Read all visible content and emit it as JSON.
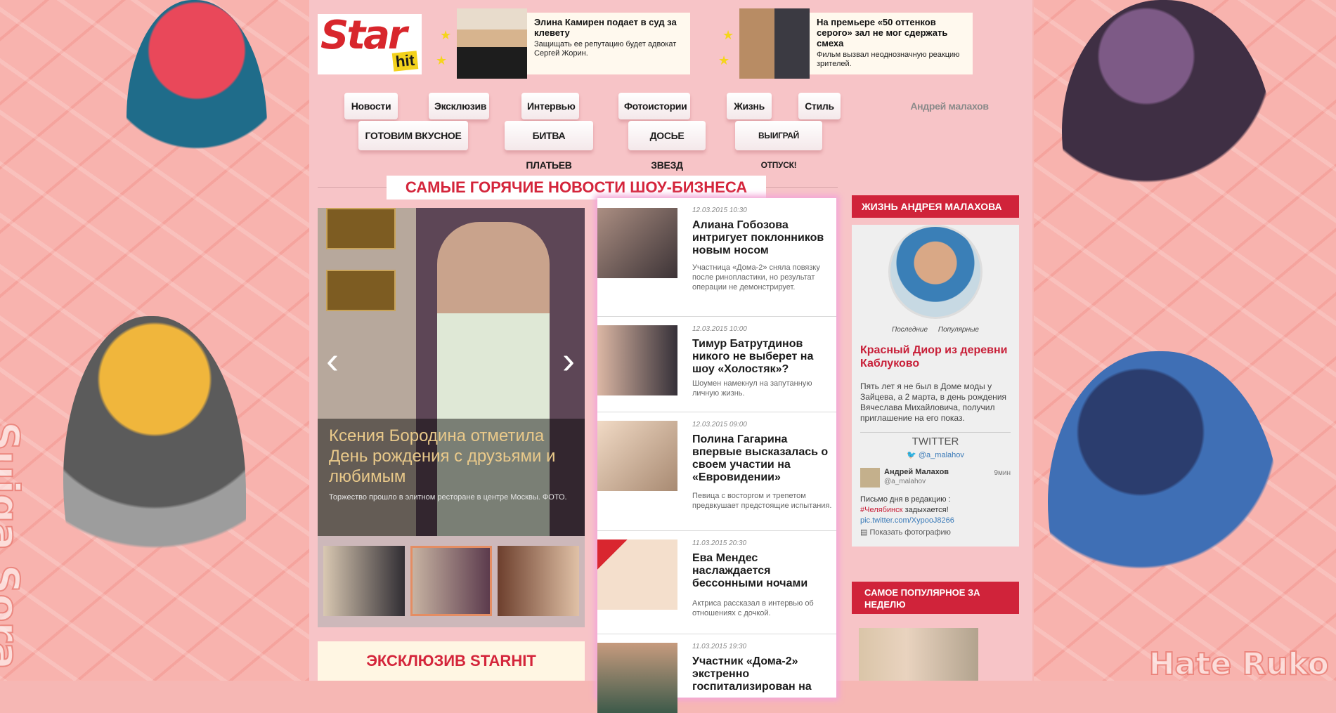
{
  "logo": {
    "star": "Star",
    "hit": "hit"
  },
  "promos": [
    {
      "title": "Элина Камирен подает в суд за клевету",
      "desc": "Защищать ее репутацию будет адвокат Сергей Жорин."
    },
    {
      "title": "На премьере «50 оттенков серого» зал не мог сдержать смеха",
      "desc": "Фильм вызвал неоднозначную реакцию зрителей."
    }
  ],
  "nav": {
    "row1": [
      "Новости",
      "Эксклюзив",
      "Интервью",
      "Фотоистории",
      "Жизнь",
      "Стиль",
      "Андрей малахов"
    ],
    "row2": [
      "ГОТОВИМ ВКУСНОЕ",
      "БИТВА ПЛАТЬЕВ",
      "ДОСЬЕ ЗВЕЗД",
      "ВЫИГРАЙ ОТПУСК!"
    ]
  },
  "section_title": "САМЫЕ ГОРЯЧИЕ НОВОСТИ ШОУ-БИЗНЕСА",
  "slider": {
    "title": "Ксения Бородина отметила День рождения с друзьями и любимым",
    "desc": "Торжество прошло в элитном ресторане в центре Москвы. ФОТО."
  },
  "news": [
    {
      "date": "12.03.2015 10:30",
      "title": "Алиана Гобозова интригует поклонников новым носом",
      "desc": "Участница «Дома-2» сняла повязку после ринопластики, но результат операции не демонстрирует."
    },
    {
      "date": "12.03.2015 10:00",
      "title": "Тимур Батрутдинов никого не выберет на шоу «Холостяк»?",
      "desc": "Шоумен намекнул на запутанную личную жизнь."
    },
    {
      "date": "12.03.2015 09:00",
      "title": "Полина Гагарина впервые высказалась о своем участии на «Евровидении»",
      "desc": "Певица с восторгом и трепетом предвкушает предстоящие испытания."
    },
    {
      "date": "11.03.2015 20:30",
      "title": "Ева Мендес наслаждается бессонными ночами",
      "desc": "Актриса рассказал в интервью об отношениях с дочкой."
    },
    {
      "date": "11.03.2015 19:30",
      "title": "Участник «Дома-2» экстренно госпитализирован на",
      "desc": ""
    }
  ],
  "right": {
    "head": "ЖИЗНЬ АНДРЕЯ МАЛАХОВА",
    "tabs": [
      "Последние",
      "Популярные"
    ],
    "link": "Красный Диор из деревни Каблуково",
    "text": "Пять лет я не был в Доме моды у Зайцева, а 2 марта, в день рождения Вячеслава Михайловича, получил приглашение на его показ.",
    "twitter_head": "TWITTER",
    "twitter_handle": "@a_malahov",
    "tweet": {
      "name": "Андрей Малахов",
      "user": "@a_malahov",
      "time": "9мин",
      "body": "Письмо дня в редакцию :",
      "tag": "#Челябинск",
      "tag_after": " задыхается!",
      "link": "pic.twitter.com/XypooJ8266",
      "show": "Показать фотографию"
    },
    "popular_head": "САМОЕ ПОПУЛЯРНОЕ ЗА НЕДЕЛЮ"
  },
  "exclusive": "ЭКСКЛЮЗИВ STARHIT",
  "side": {
    "left_text": "Suiga Sora",
    "right_text": "Hate Ruko"
  },
  "colors": {
    "accent": "#d0233a",
    "page_bg": "#f7c4c7",
    "side_bg": "#f8b3ae"
  }
}
